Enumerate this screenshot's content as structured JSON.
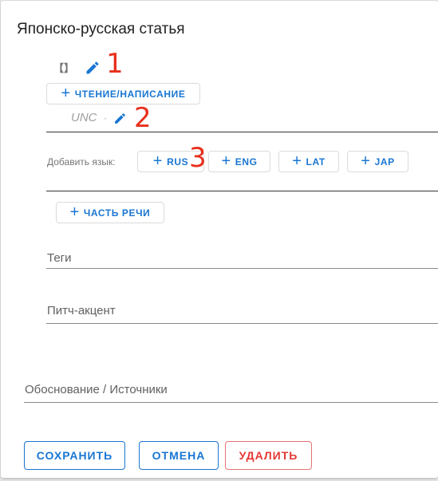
{
  "dialog": {
    "title": "Японско-русская статья",
    "headword_glyph": "【】",
    "annotation_1": "1",
    "annotation_2": "2",
    "annotation_3": "3",
    "reading_writing_button": "ЧТЕНИЕ/НАПИСАНИЕ",
    "reading_value": "UNC",
    "reading_separator": "·",
    "add_language_label": "Добавить язык:",
    "languages": [
      "RUS",
      "ENG",
      "LAT",
      "JAP"
    ],
    "part_of_speech_button": "ЧАСТЬ РЕЧИ",
    "tags_label": "Теги",
    "pitch_accent_label": "Питч-акцент",
    "sources_label": "Обоснование / Источники",
    "save_button": "СОХРАНИТЬ",
    "cancel_button": "ОТМЕНА",
    "delete_button": "УДАЛИТЬ"
  },
  "colors": {
    "accent": "#1976d2",
    "danger": "#e53935",
    "annotation": "#e8301c"
  },
  "icons": [
    "edit-pencil-icon",
    "plus-icon"
  ]
}
